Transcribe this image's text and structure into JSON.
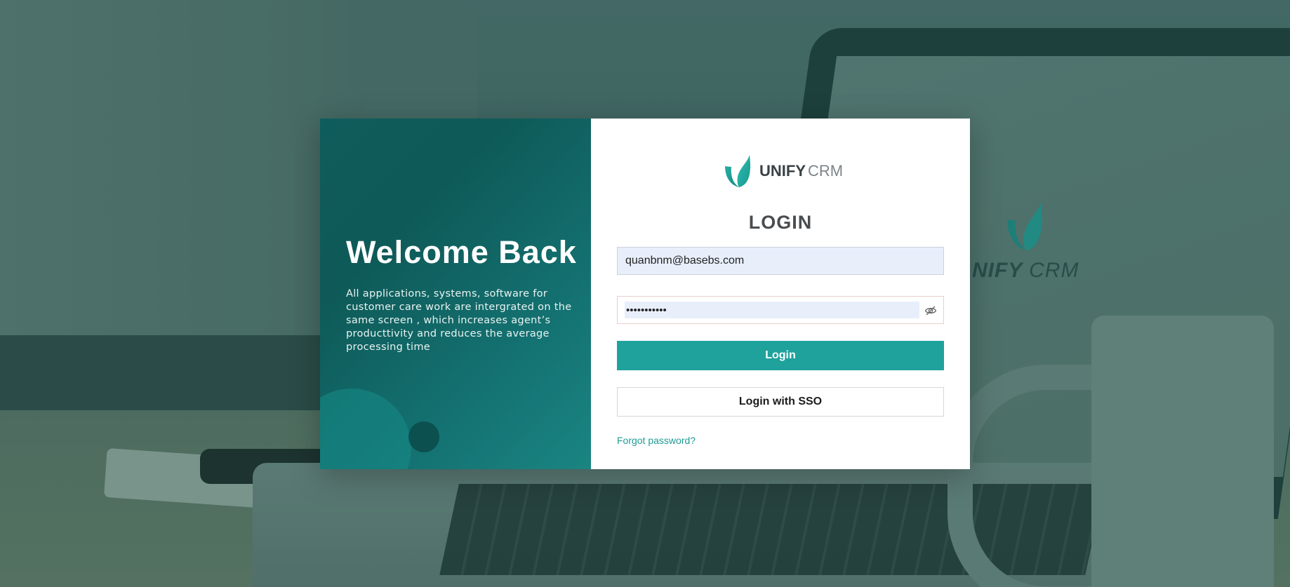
{
  "brand": {
    "name_bold": "UNIFY",
    "name_light": "CRM",
    "accent_color": "#1fa29c"
  },
  "welcome": {
    "title": "Welcome Back",
    "description": "All applications, systems, software for customer care work are intergrated on the same screen , which increases agent’s producttivity and reduces the average processing time"
  },
  "login_form": {
    "heading": "LOGIN",
    "email_value": "quanbnm@basebs.com",
    "password_value": "•••••••••••",
    "password_toggle_icon": "eye-slash-icon",
    "login_button": "Login",
    "sso_button": "Login with SSO",
    "forgot_link": "Forgot password?"
  }
}
